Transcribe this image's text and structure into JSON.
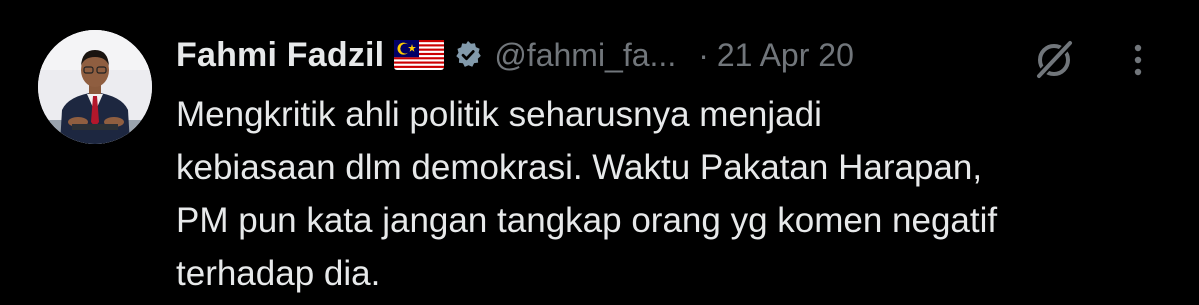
{
  "author": {
    "display_name": "Fahmi Fadzil",
    "flag_icon": "malaysia-flag-icon",
    "verified_icon": "verified-badge-icon",
    "verified_color": "#829aab",
    "handle": "@fahmi_fa...",
    "avatar_icon": "profile-photo"
  },
  "meta": {
    "separator": "·",
    "timestamp": "21 Apr 20"
  },
  "actions": {
    "grok_icon": "grok-icon",
    "more_icon": "more-options-icon"
  },
  "tweet": {
    "lines": [
      "Mengkritik ahli politik seharusnya menjadi",
      "kebiasaan dlm demokrasi. Waktu Pakatan Harapan,",
      "PM pun kata jangan tangkap orang yg komen negatif",
      "terhadap dia."
    ]
  },
  "colors": {
    "background": "#000000",
    "text_primary": "#e7e9ea",
    "text_secondary": "#71767b"
  }
}
